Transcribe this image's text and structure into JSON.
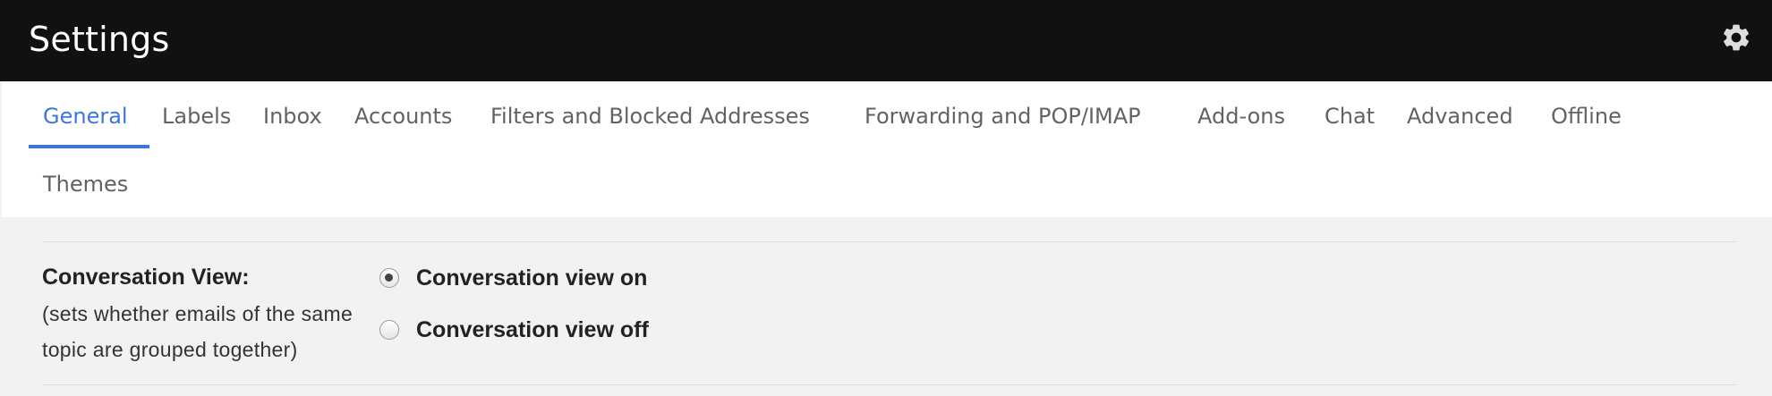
{
  "header": {
    "title": "Settings",
    "settings_icon": "gear-icon"
  },
  "tabs": [
    {
      "label": "General",
      "active": true
    },
    {
      "label": "Labels"
    },
    {
      "label": "Inbox"
    },
    {
      "label": "Accounts"
    },
    {
      "label": "Filters and Blocked Addresses"
    },
    {
      "label": "Forwarding and POP/IMAP"
    },
    {
      "label": "Add-ons"
    },
    {
      "label": "Chat"
    },
    {
      "label": "Advanced"
    },
    {
      "label": "Offline"
    },
    {
      "label": "Themes"
    }
  ],
  "conversation_view": {
    "label": "Conversation View:",
    "description": "(sets whether emails of the same topic are grouped together)",
    "options": [
      {
        "label": "Conversation view on",
        "selected": true
      },
      {
        "label": "Conversation view off",
        "selected": false
      }
    ]
  },
  "colors": {
    "header_bg": "#111111",
    "accent": "#3c78d8",
    "tab_text": "#5f6368",
    "content_bg": "#f2f2f2"
  }
}
